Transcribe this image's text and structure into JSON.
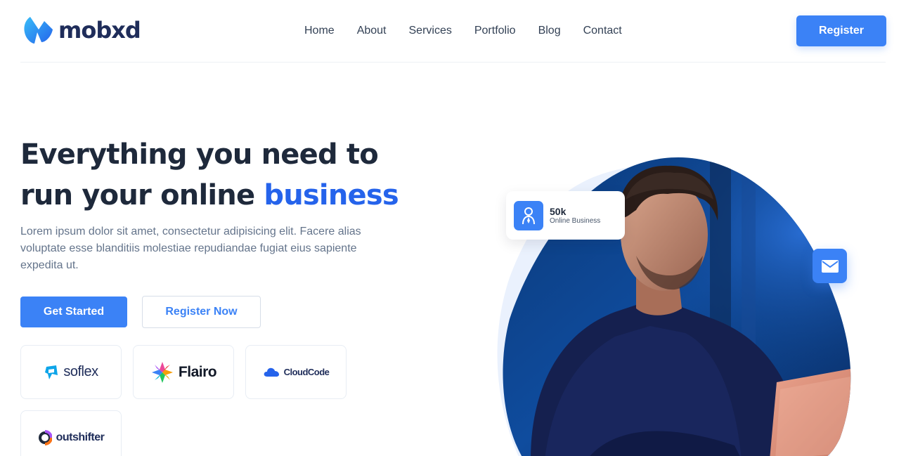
{
  "brand": {
    "name": "mobxd",
    "color": "#3b82f6"
  },
  "nav": {
    "items": [
      {
        "label": "Home"
      },
      {
        "label": "About"
      },
      {
        "label": "Services"
      },
      {
        "label": "Portfolio"
      },
      {
        "label": "Blog"
      },
      {
        "label": "Contact"
      }
    ],
    "register_label": "Register"
  },
  "hero": {
    "title_part1": "Everything you need to",
    "title_part2": "run your online ",
    "title_accent": "business",
    "description": "Lorem ipsum dolor sit amet, consectetur adipisicing elit. Facere alias voluptate esse blanditiis molestiae repudiandae fugiat eius sapiente expedita ut.",
    "primary_button": "Get Started",
    "secondary_button": "Register Now",
    "accent_color": "#2563eb"
  },
  "partners": [
    {
      "name": "soflex",
      "icon": "soflex-logo"
    },
    {
      "name": "Flairo",
      "icon": "flairo-logo"
    },
    {
      "name": "CloudCode",
      "icon": "cloudcode-logo"
    },
    {
      "name": "outshifter",
      "icon": "outshifter-logo"
    }
  ],
  "stat_card": {
    "value": "50k",
    "label": "Online Business",
    "icon": "user-icon"
  },
  "mail_button": {
    "icon": "mail-icon"
  }
}
